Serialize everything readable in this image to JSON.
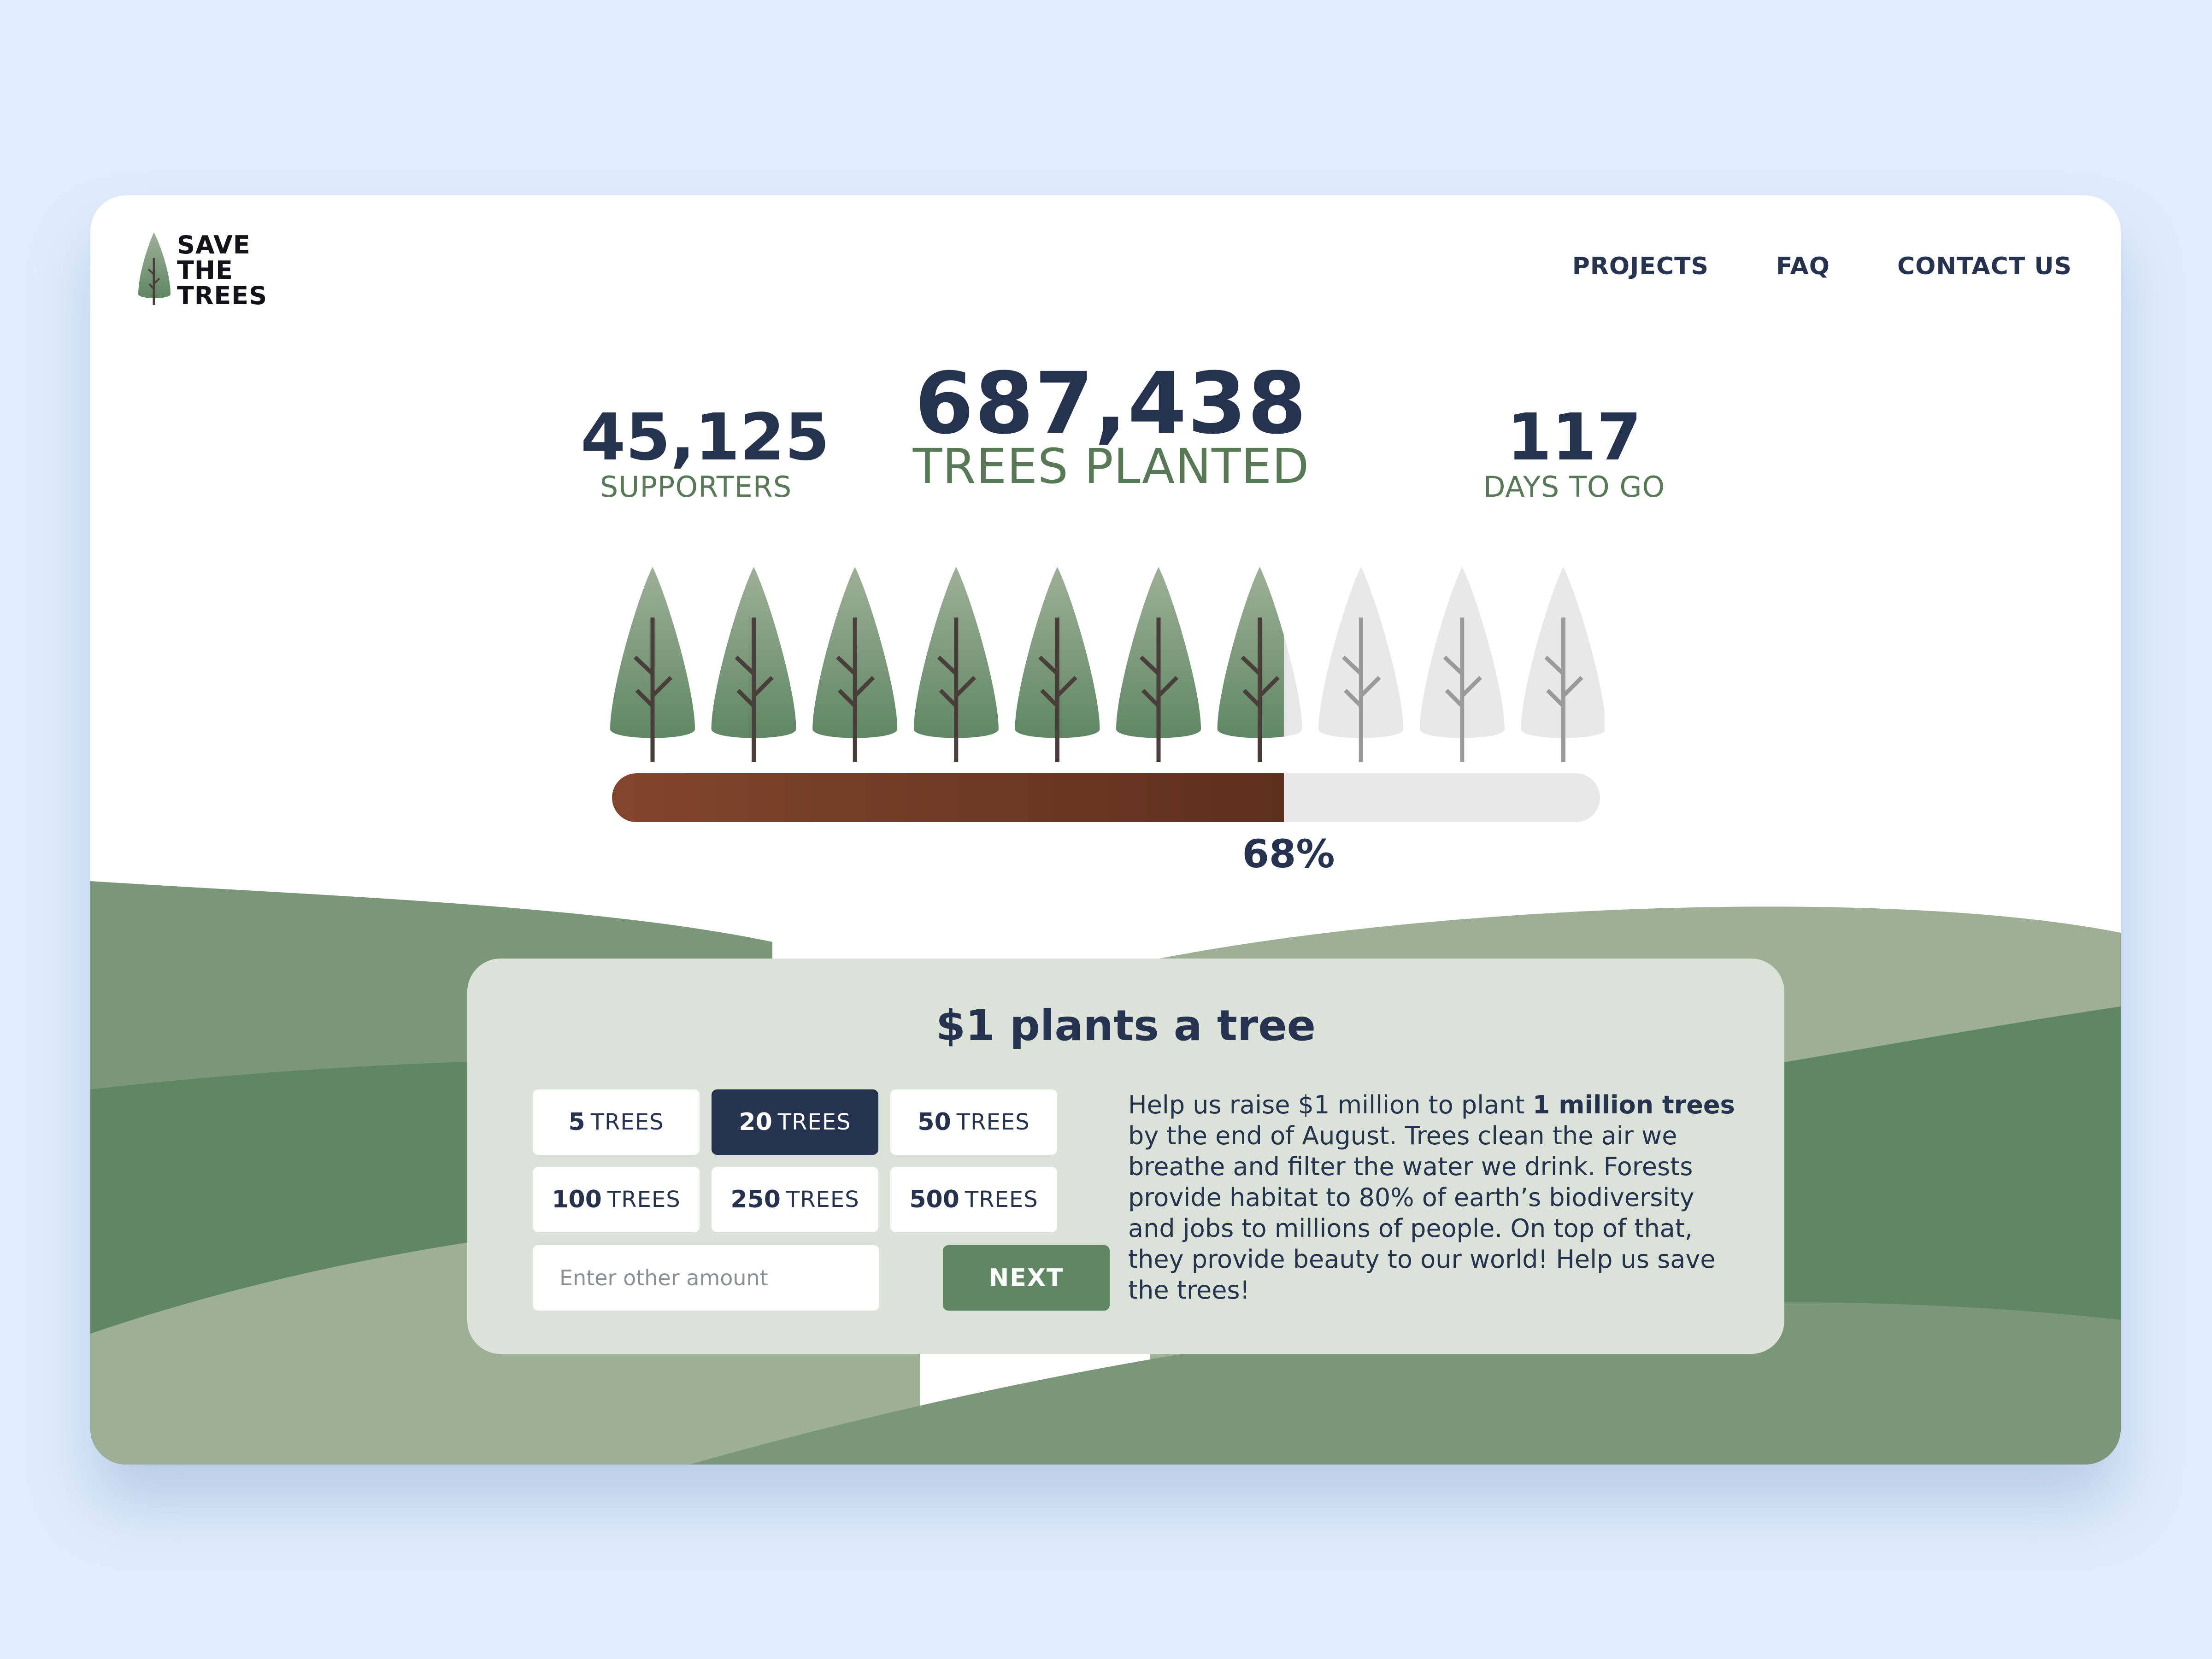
{
  "brand": {
    "line1": "SAVE",
    "line2": "THE",
    "line3": "TREES"
  },
  "nav": {
    "projects": "PROJECTS",
    "faq": "FAQ",
    "contact": "CONTACT US"
  },
  "stats": {
    "supporters": {
      "value": "45,125",
      "label": "SUPPORTERS"
    },
    "trees": {
      "value": "687,438",
      "label": "TREES PLANTED"
    },
    "days": {
      "value": "117",
      "label": "DAYS TO GO"
    }
  },
  "progress": {
    "percent": 68,
    "label": "68%",
    "tree_count": 10
  },
  "donate": {
    "title": "$1 plants a tree",
    "options": [
      {
        "count": "5",
        "unit": "TREES",
        "selected": false
      },
      {
        "count": "20",
        "unit": "TREES",
        "selected": true
      },
      {
        "count": "50",
        "unit": "TREES",
        "selected": false
      },
      {
        "count": "100",
        "unit": "TREES",
        "selected": false
      },
      {
        "count": "250",
        "unit": "TREES",
        "selected": false
      },
      {
        "count": "500",
        "unit": "TREES",
        "selected": false
      }
    ],
    "amount_placeholder": "Enter other amount",
    "next_label": "NEXT",
    "description": {
      "before": "Help us raise $1 million to plant ",
      "bold": "1 million trees",
      "after": " by the end of August. Trees clean the air we breathe and filter the water we drink. Forests provide habitat to 80% of earth’s biodiversity and jobs to millions of people. On top of that, they provide beauty to our world! Help us save the trees!"
    }
  },
  "colors": {
    "navy": "#263350",
    "green": "#5f8764",
    "progress_brown": "#7a3f26",
    "background": "#dfecfd"
  }
}
